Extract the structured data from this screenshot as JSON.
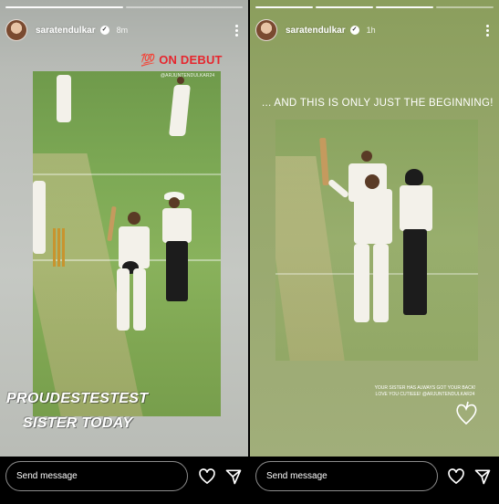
{
  "stories": [
    {
      "username": "saratendulkar",
      "time": "8m",
      "debut_badge": "💯 ON DEBUT",
      "photo_tag": "@ARJUNTENDULKAR24",
      "caption_line1": "PROUDESTESTEST",
      "caption_line2": "SISTER TODAY",
      "message_placeholder": "Send message",
      "icons": [
        "avatar",
        "verified-icon",
        "more-icon",
        "heart-icon",
        "send-icon"
      ]
    },
    {
      "username": "saratendulkar",
      "time": "1h",
      "headline": "... AND THIS IS ONLY JUST THE BEGINNING!",
      "note_line1": "YOUR SISTER HAS ALWAYS GOT YOUR BACK!",
      "note_line2": "LOVE YOU CUTIEEE! @ARJUNTENDULKAR24",
      "message_placeholder": "Send message",
      "icons": [
        "avatar",
        "verified-icon",
        "more-icon",
        "heart-sticker",
        "heart-icon",
        "send-icon"
      ]
    }
  ],
  "colors": {
    "debut_red": "#e6262e",
    "left_bg": "#b8bbb6",
    "right_bg": "#97a86c",
    "grass": "#7da955"
  }
}
